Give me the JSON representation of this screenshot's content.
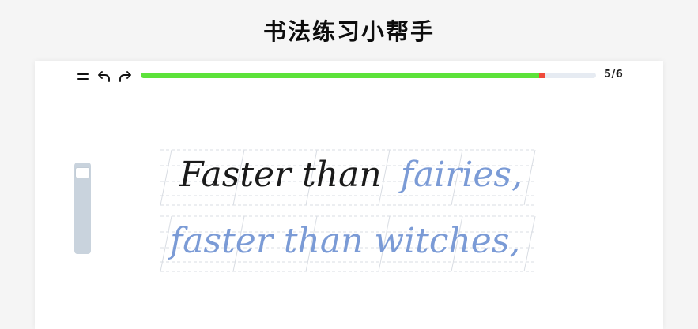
{
  "app": {
    "title": "书法练习小帮手"
  },
  "toolbar": {
    "menu_icon": "hamburger-icon",
    "undo_icon": "undo-arrow-icon",
    "redo_icon": "redo-arrow-icon",
    "page_counter": "5/6"
  },
  "progress": {
    "filled_fraction": 0.88,
    "fill_color": "#5ce23a",
    "marker_color": "#ef4a3b",
    "track_color": "#e6ebf2"
  },
  "size_slider": {
    "level": 0.05,
    "track_color": "#c9d3dd"
  },
  "practice": {
    "lines": [
      {
        "traced": "Faster than",
        "guide": "fairies,"
      },
      {
        "traced": "",
        "guide": "faster than witches,"
      }
    ],
    "traced_color": "#1b1b1b",
    "guide_color": "#7b9bd6",
    "rule_color": "#d9dde3"
  }
}
